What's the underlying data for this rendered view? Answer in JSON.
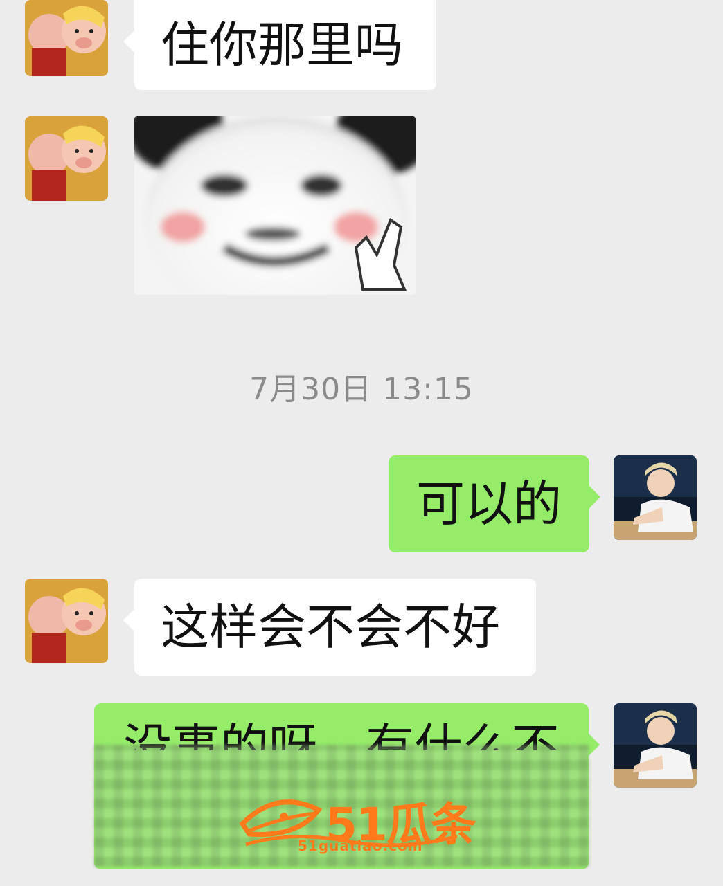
{
  "messages": {
    "m1": {
      "text": "住你那里吗"
    },
    "timestamp": "7月30日 13:15",
    "m2": {
      "text": "可以的"
    },
    "m3": {
      "text": "这样会不会不好"
    },
    "m4": {
      "text_visible": "没事的呀，有什么不"
    }
  },
  "watermark": {
    "brand": "51瓜条",
    "url": "51guatiao.com",
    "color": "#ff7a1a"
  },
  "colors": {
    "background": "#ececec",
    "bubble_incoming": "#ffffff",
    "bubble_outgoing": "#95ec69"
  },
  "icons": {
    "contact_avatar": "cartoon-pigs-avatar-icon",
    "self_avatar": "person-photo-avatar-icon",
    "sticker": "panda-meme-sticker"
  }
}
